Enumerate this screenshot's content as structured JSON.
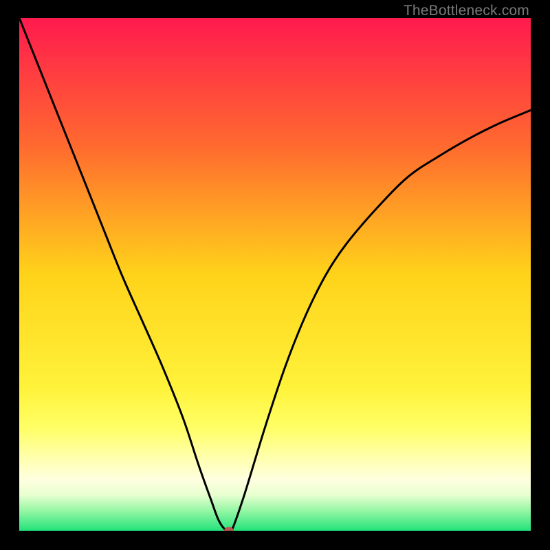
{
  "watermark": "TheBottleneck.com",
  "colors": {
    "black": "#000000",
    "curve": "#000000",
    "marker": "#b65a52"
  },
  "chart_data": {
    "type": "line",
    "title": "",
    "xlabel": "",
    "ylabel": "",
    "xlim": [
      0,
      100
    ],
    "ylim": [
      0,
      100
    ],
    "gradient_stops": [
      {
        "offset": 0,
        "color": "#ff1a4e"
      },
      {
        "offset": 25,
        "color": "#ff6a2f"
      },
      {
        "offset": 50,
        "color": "#ffd31a"
      },
      {
        "offset": 72,
        "color": "#fff23a"
      },
      {
        "offset": 80,
        "color": "#ffff66"
      },
      {
        "offset": 86,
        "color": "#ffffb0"
      },
      {
        "offset": 90,
        "color": "#ffffe0"
      },
      {
        "offset": 93,
        "color": "#e8ffd0"
      },
      {
        "offset": 96,
        "color": "#98f7a6"
      },
      {
        "offset": 100,
        "color": "#22e37a"
      }
    ],
    "series": [
      {
        "name": "bottleneck-curve",
        "x": [
          0,
          4,
          8,
          12,
          16,
          20,
          24,
          28,
          32,
          35,
          37.5,
          39,
          40.5,
          41.5,
          44,
          48,
          52,
          56,
          60,
          64,
          70,
          76,
          82,
          88,
          94,
          100
        ],
        "y": [
          100,
          90,
          80,
          70,
          60,
          50,
          41,
          32,
          22,
          13,
          6,
          2,
          0,
          0,
          7,
          20,
          32,
          42,
          50,
          56,
          63,
          69,
          73,
          76.5,
          79.5,
          82
        ]
      }
    ],
    "marker": {
      "x": 41,
      "y": 0
    }
  }
}
